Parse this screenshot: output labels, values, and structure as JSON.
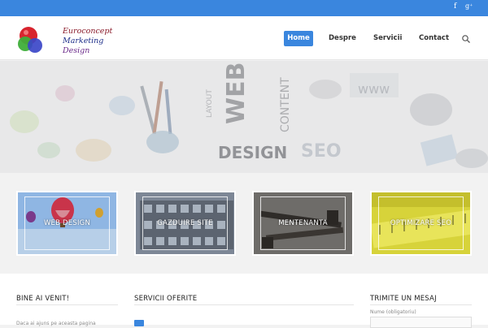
{
  "topbar": {
    "social": [
      {
        "name": "facebook-icon",
        "glyph": "f"
      },
      {
        "name": "google-plus-icon",
        "glyph": "g⁺"
      }
    ]
  },
  "header": {
    "logo": {
      "line1": "Euroconcept",
      "line2": "Marketing",
      "line3": "Design"
    },
    "nav": {
      "home": "Home",
      "despre": "Despre",
      "servicii": "Servicii",
      "contact": "Contact"
    },
    "accent_color": "#3a86de"
  },
  "services": [
    {
      "label": "WEB DESIGN"
    },
    {
      "label": "GAZDUIRE SITE"
    },
    {
      "label": "MENTENANTA"
    },
    {
      "label": "OPTIMIZARE SEO"
    }
  ],
  "widgets": {
    "welcome": {
      "title": "BINE AI VENIT!",
      "text": "Daca ai ajuns pe aceasta pagina"
    },
    "services_offered": {
      "title": "SERVICII OFERITE"
    },
    "message": {
      "title": "TRIMITE UN MESAJ",
      "name_label": "Nume (obligatoriu)"
    }
  }
}
